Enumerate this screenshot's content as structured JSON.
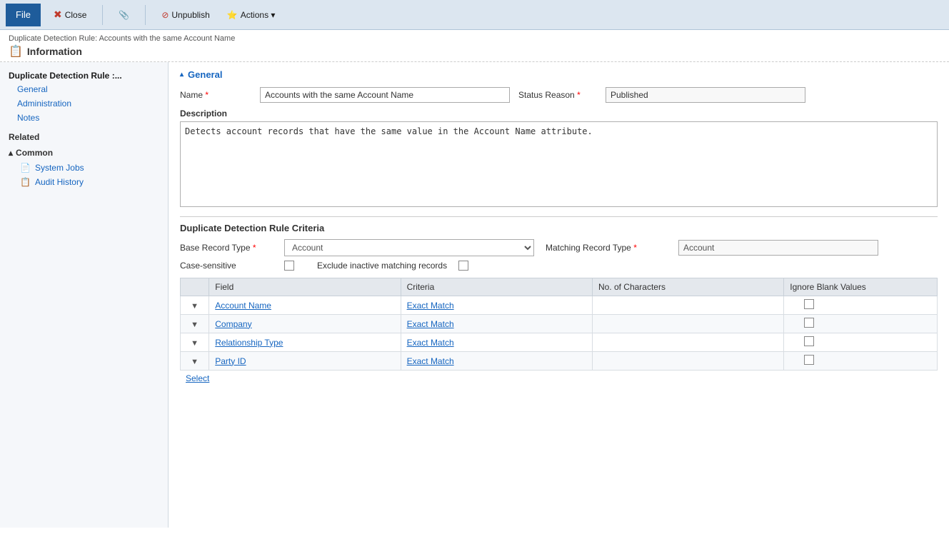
{
  "toolbar": {
    "file_label": "File",
    "close_label": "Close",
    "unpublish_label": "Unpublish",
    "actions_label": "Actions ▾"
  },
  "header": {
    "breadcrumb": "Duplicate Detection Rule: Accounts with the same Account Name",
    "title": "Information",
    "icon": "📋"
  },
  "sidebar": {
    "section_title": "Duplicate Detection Rule :...",
    "nav_items": [
      {
        "label": "General"
      },
      {
        "label": "Administration"
      },
      {
        "label": "Notes"
      }
    ],
    "related_label": "Related",
    "common_label": "▴ Common",
    "common_items": [
      {
        "label": "System Jobs",
        "icon": "📄"
      },
      {
        "label": "Audit History",
        "icon": "📋"
      }
    ]
  },
  "general": {
    "section_label": "General",
    "name_label": "Name",
    "name_value": "Accounts with the same Account Name",
    "name_placeholder": "Accounts with the same Account Name",
    "status_reason_label": "Status Reason",
    "status_reason_value": "Published",
    "description_label": "Description",
    "description_value": "Detects account records that have the same value in the Account Name attribute."
  },
  "criteria": {
    "title": "Duplicate Detection Rule Criteria",
    "base_record_type_label": "Base Record Type",
    "base_record_type_value": "Account",
    "matching_record_type_label": "Matching Record Type",
    "matching_record_type_value": "Account",
    "case_sensitive_label": "Case-sensitive",
    "exclude_inactive_label": "Exclude inactive matching records",
    "table_headers": [
      "Field",
      "Criteria",
      "No. of Characters",
      "Ignore Blank Values"
    ],
    "rows": [
      {
        "field": "Account Name",
        "criteria": "Exact Match"
      },
      {
        "field": "Company",
        "criteria": "Exact Match"
      },
      {
        "field": "Relationship Type",
        "criteria": "Exact Match"
      },
      {
        "field": "Party ID",
        "criteria": "Exact Match"
      }
    ],
    "select_label": "Select"
  },
  "colors": {
    "link": "#1565c0",
    "toolbar_bg": "#dce6f0",
    "sidebar_bg": "#f5f7fa",
    "file_btn": "#1e5c9b"
  }
}
